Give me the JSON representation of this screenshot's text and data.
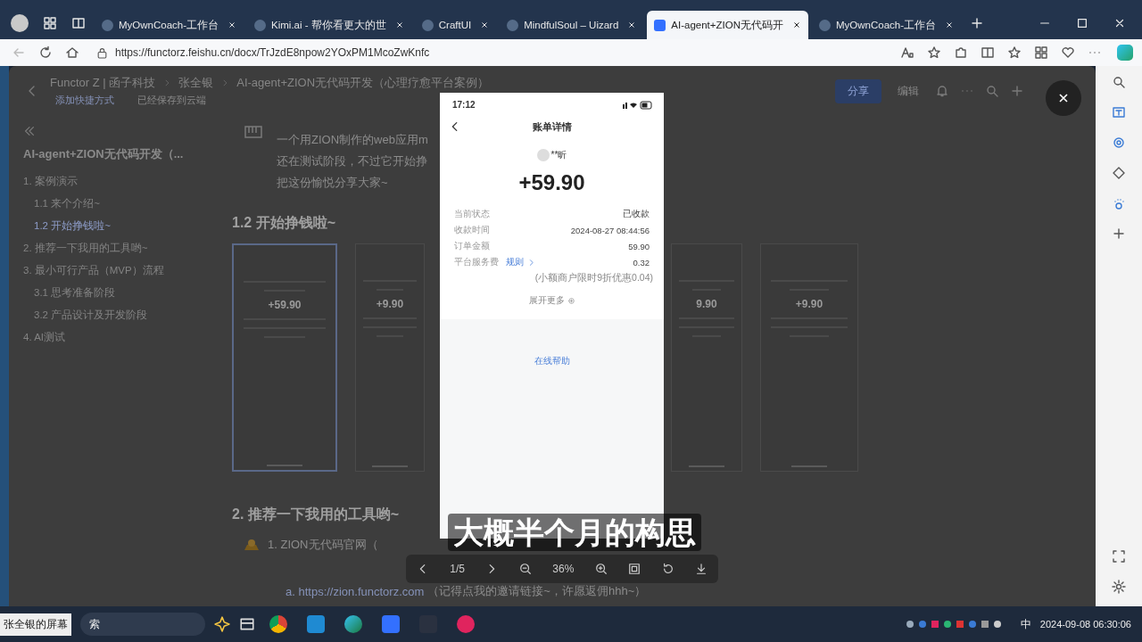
{
  "browser": {
    "tabs": [
      {
        "title": "MyOwnCoach-工作台",
        "selected": false
      },
      {
        "title": "Kimi.ai - 帮你看更大的世",
        "selected": false
      },
      {
        "title": "CraftUI",
        "selected": false
      },
      {
        "title": "MindfulSoul – Uizard",
        "selected": false
      },
      {
        "title": "AI-agent+ZION无代码开",
        "selected": true
      },
      {
        "title": "MyOwnCoach-工作台",
        "selected": false
      }
    ],
    "url": "https://functorz.feishu.cn/docx/TrJzdE8npow2YOxPM1McoZwKnfc"
  },
  "doc": {
    "breadcrumb": [
      "Functor Z | 函子科技",
      "张全银",
      "AI-agent+ZION无代码开发（心理疗愈平台案例）"
    ],
    "shortcut": "添加快捷方式",
    "saved": "已经保存到云端",
    "share_button": "分享",
    "edit_button": "编辑",
    "outline": {
      "title": "AI-agent+ZION无代码开发（...",
      "items": [
        {
          "label": "1. 案例演示",
          "selected": false,
          "children": [
            {
              "label": "1.1 来个介绍~",
              "selected": false
            },
            {
              "label": "1.2 开始挣钱啦~",
              "selected": true
            }
          ]
        },
        {
          "label": "2. 推荐一下我用的工具哟~",
          "selected": false
        },
        {
          "label": "3. 最小可行产品（MVP）流程",
          "selected": false,
          "children": [
            {
              "label": "3.1 思考准备阶段",
              "selected": false
            },
            {
              "label": "3.2 产品设计及开发阶段",
              "selected": false
            }
          ]
        },
        {
          "label": "4. AI测试",
          "selected": false
        }
      ]
    },
    "paragraphs": [
      "一个用ZION制作的web应用m",
      "还在测试阶段，不过它开始挣",
      "把这份愉悦分享大家~"
    ],
    "heading": "1.2 开始挣钱啦~",
    "thumbnails": [
      {
        "amount": "+59.90",
        "selected": true
      },
      {
        "amount": "+9.90",
        "selected": false
      },
      {
        "amount": "9.90",
        "selected": false
      },
      {
        "amount": "+9.90",
        "selected": false
      }
    ],
    "heading_2": "2. 推荐一下我用的工具哟~",
    "list_item": "1. ZION无代码官网（",
    "link": "a. https://zion.functorz.com",
    "link_note": "（记得点我的邀请链接~，许愿返佣hhh~）"
  },
  "phone": {
    "time": "17:12",
    "title": "账单详情",
    "payer": "**昕",
    "amount": "+59.90",
    "rows": [
      {
        "label": "当前状态",
        "value": "已收款"
      },
      {
        "label": "收款时间",
        "value": "2024-08-27 08:44:56"
      },
      {
        "label": "订单金额",
        "value": "59.90"
      },
      {
        "label": "平台服务费",
        "link": "规则",
        "value": "0.32"
      }
    ],
    "note": "(小额商户限时9折优惠0.04)",
    "more": "展开更多",
    "help": "在线帮助"
  },
  "viewer": {
    "counter": "1/5",
    "zoom": "36%"
  },
  "subtitle": "大概半个月的构思",
  "taskbar": {
    "screen_label": "张全银的屏幕",
    "search": "索",
    "ime": "中",
    "clock": "2024-09-08 06:30:06"
  }
}
